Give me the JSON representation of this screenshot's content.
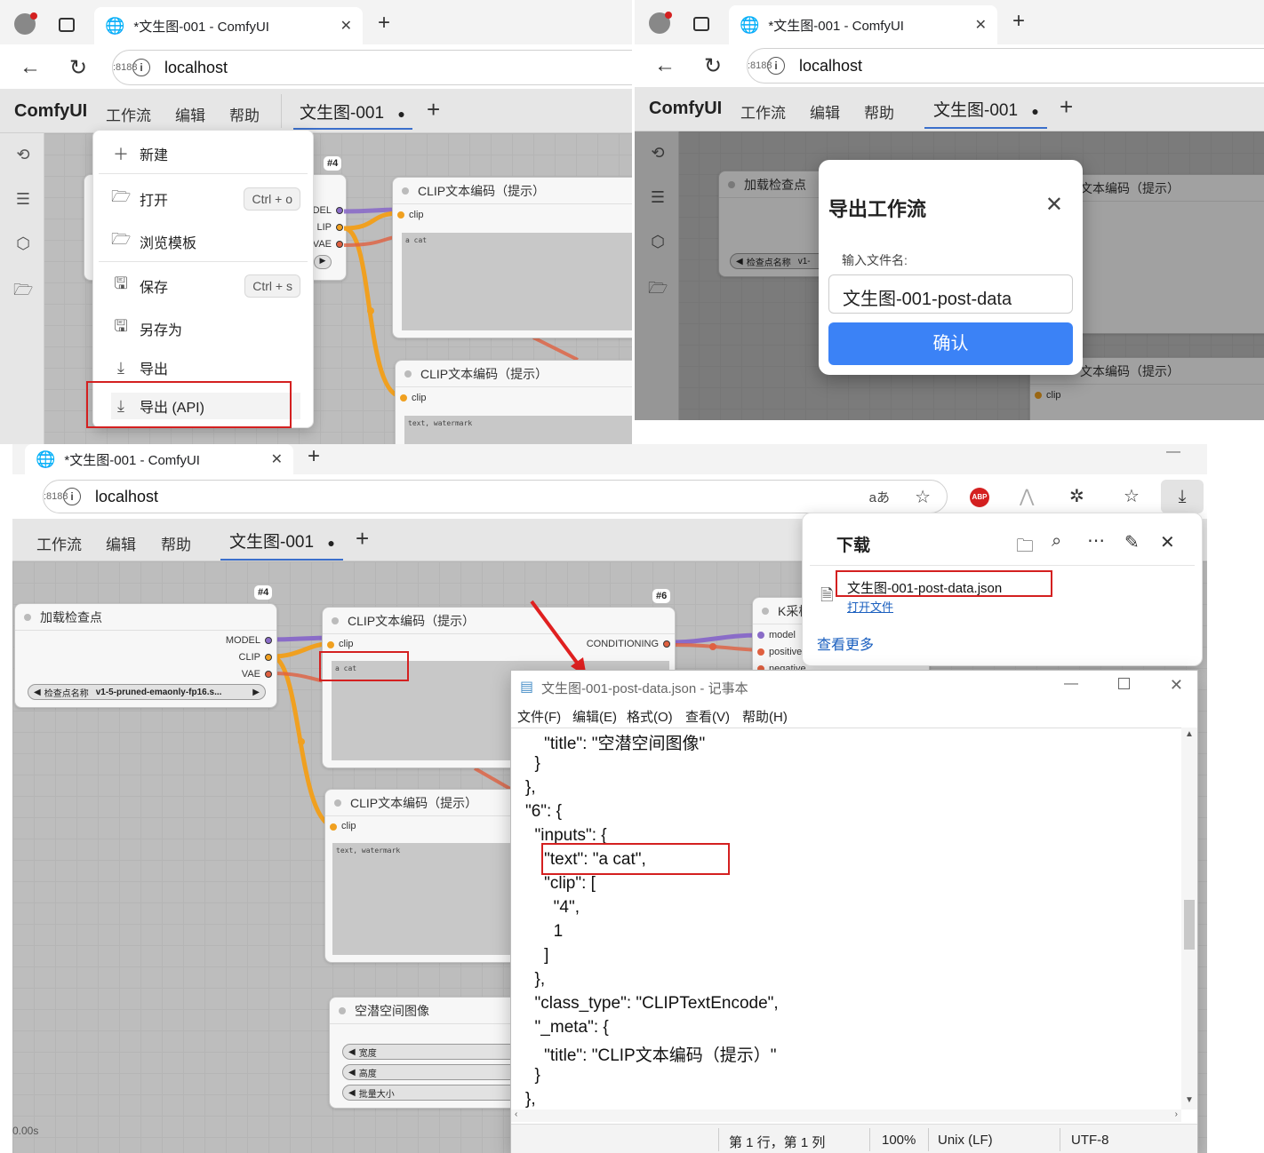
{
  "browser": {
    "tab_title": "*文生图-001 - ComfyUI",
    "host": "localhost",
    "port": ":8188"
  },
  "comfy": {
    "brand": "ComfyUI",
    "menus": [
      "工作流",
      "编辑",
      "帮助"
    ],
    "workflow_tab": "文生图-001",
    "unsaved_marker": "●",
    "add_tab": "+"
  },
  "workflow_menu": {
    "items": [
      {
        "icon": "plus-icon",
        "label": "新建",
        "shortcut": ""
      },
      {
        "icon": "folder-open-icon",
        "label": "打开",
        "shortcut": "Ctrl + o"
      },
      {
        "icon": "folder-open-icon",
        "label": "浏览模板",
        "shortcut": ""
      },
      {
        "icon": "save-icon",
        "label": "保存",
        "shortcut": "Ctrl + s"
      },
      {
        "icon": "save-icon",
        "label": "另存为",
        "shortcut": ""
      },
      {
        "icon": "download-icon",
        "label": "导出",
        "shortcut": ""
      },
      {
        "icon": "download-icon",
        "label": "导出 (API)",
        "shortcut": ""
      }
    ]
  },
  "nodes": {
    "checkpoint_title": "加载检查点",
    "checkpoint_widget_label": "检查点名称",
    "checkpoint_widget_value": "v1-5-pruned-emaonly-fp16.s...",
    "checkpoint_widget_short": "v1-",
    "out_model": "MODEL",
    "out_clip": "CLIP",
    "out_vae": "VAE",
    "out_model_cut": "MODEL",
    "out_clip_cut": "LIP",
    "out_vae_cut": "VAE",
    "clip_title": "CLIP文本编码（提示）",
    "clip_title_cut": "文本编码（提示）",
    "clip_input": "clip",
    "clip_output": "CONDITIONING",
    "positive_text": "a cat",
    "negative_text": "text, watermark",
    "badge_4": "#4",
    "badge_6": "#6",
    "ksampler_title": "K采样",
    "ks_model": "model",
    "ks_positive": "positive",
    "ks_negative": "negative",
    "latent_title": "空潜空间图像",
    "latent_width": "宽度",
    "latent_height": "高度",
    "latent_batch": "批量大小",
    "canvas_time": "0.00s"
  },
  "export_dialog": {
    "title": "导出工作流",
    "label": "输入文件名:",
    "value": "文生图-001-post-data",
    "confirm": "确认"
  },
  "downloads": {
    "title": "下载",
    "file_name": "文生图-001-post-data.json",
    "open_link": "打开文件",
    "see_more": "查看更多",
    "translate_icon": "aあ",
    "abp": "ABP"
  },
  "notepad": {
    "title": "文生图-001-post-data.json - 记事本",
    "menus": [
      "文件(F)",
      "编辑(E)",
      "格式(O)",
      "查看(V)",
      "帮助(H)"
    ],
    "lines": [
      "    \"title\": \"空潜空间图像\"",
      "  }",
      "},",
      "\"6\": {",
      "  \"inputs\": {",
      "    \"text\": \"a cat\",",
      "    \"clip\": [",
      "      \"4\",",
      "      1",
      "    ]",
      "  },",
      "  \"class_type\": \"CLIPTextEncode\",",
      "  \"_meta\": {",
      "    \"title\": \"CLIP文本编码（提示）\"",
      "  }",
      "},"
    ],
    "status_pos": "第 1 行，第 1 列",
    "status_zoom": "100%",
    "status_eol": "Unix (LF)",
    "status_enc": "UTF-8"
  },
  "colors": {
    "accent_blue": "#3b82f6",
    "annotation_red": "#d42020",
    "wire_clip": "#f0a020",
    "wire_model": "#8a6cc8",
    "wire_vae": "#e06040"
  }
}
